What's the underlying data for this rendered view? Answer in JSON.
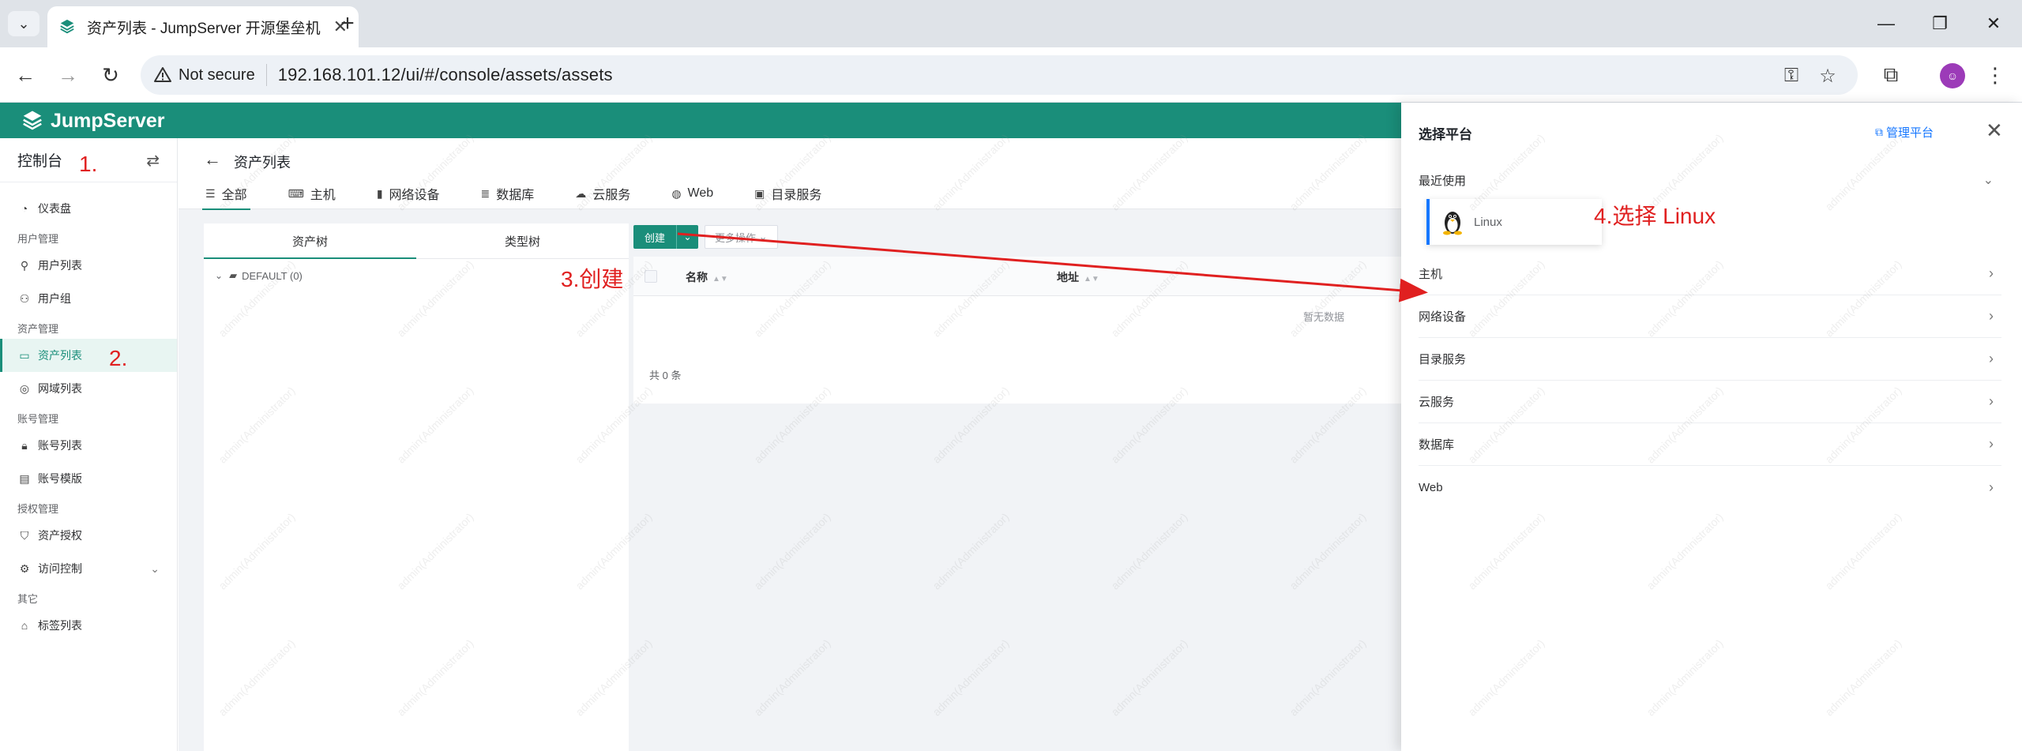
{
  "browser": {
    "tab_title": "资产列表 - JumpServer 开源堡垒机",
    "not_secure": "Not secure",
    "url": "192.168.101.12/ui/#/console/assets/assets"
  },
  "app": {
    "brand": "JumpServer",
    "accent": "#1a8e7a"
  },
  "sidebar": {
    "title": "控制台",
    "items": {
      "dashboard": "仪表盘",
      "group_user": "用户管理",
      "user_list": "用户列表",
      "user_group": "用户组",
      "group_asset": "资产管理",
      "asset_list": "资产列表",
      "domain_list": "网域列表",
      "group_account": "账号管理",
      "account_list": "账号列表",
      "account_template": "账号模版",
      "group_perm": "授权管理",
      "asset_perm": "资产授权",
      "access_control": "访问控制",
      "group_other": "其它",
      "label_list": "标签列表"
    }
  },
  "page": {
    "title": "资产列表",
    "tabs": {
      "all": "全部",
      "host": "主机",
      "network": "网络设备",
      "database": "数据库",
      "cloud": "云服务",
      "web": "Web",
      "directory": "目录服务"
    }
  },
  "tree": {
    "tab_asset": "资产树",
    "tab_type": "类型树",
    "node": "DEFAULT (0)"
  },
  "toolbar": {
    "create": "创建",
    "more": "更多操作"
  },
  "table": {
    "col_name": "名称",
    "col_address": "地址",
    "empty": "暂无数据",
    "total": "共 0 条"
  },
  "drawer": {
    "title": "选择平台",
    "manage": "管理平台",
    "recent": "最近使用",
    "recent_item": "Linux",
    "categories": {
      "host": "主机",
      "network": "网络设备",
      "directory": "目录服务",
      "cloud": "云服务",
      "database": "数据库",
      "web": "Web"
    }
  },
  "annotations": {
    "a1": "1.",
    "a2": "2.",
    "a3": "3.创建",
    "a4": "4.选择 Linux"
  },
  "watermark": "admin(Administrator)"
}
